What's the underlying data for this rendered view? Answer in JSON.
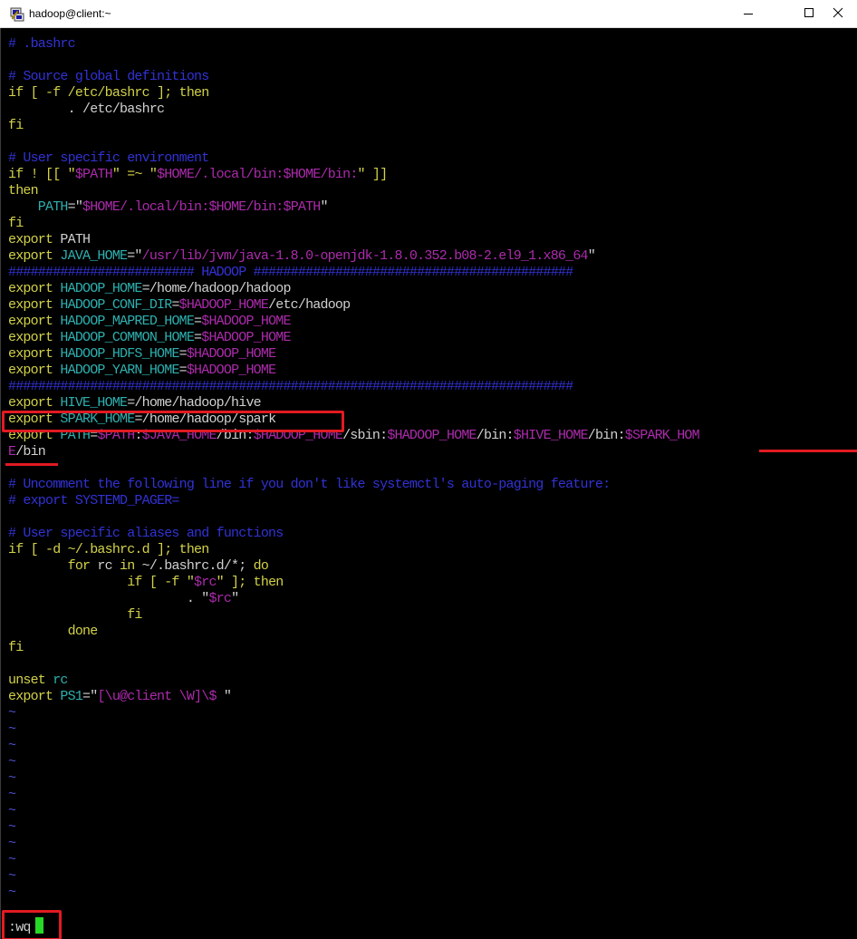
{
  "window": {
    "title": "hadoop@client:~",
    "controls": {
      "minimize": "minimize",
      "maximize": "maximize",
      "close": "close"
    }
  },
  "editor": {
    "lines": [
      [
        {
          "t": "# .bashrc",
          "c": "c-blue"
        }
      ],
      [
        {
          "t": "",
          "c": "c-wht"
        }
      ],
      [
        {
          "t": "# Source global definitions",
          "c": "c-blue"
        }
      ],
      [
        {
          "t": "if [ -f /etc/bashrc ]; then",
          "c": "c-yel"
        }
      ],
      [
        {
          "t": "        . /etc/bashrc",
          "c": "c-wht"
        }
      ],
      [
        {
          "t": "fi",
          "c": "c-yel"
        }
      ],
      [
        {
          "t": "",
          "c": "c-wht"
        }
      ],
      [
        {
          "t": "# User specific environment",
          "c": "c-blue"
        }
      ],
      [
        {
          "t": "if ! [[ \"",
          "c": "c-yel"
        },
        {
          "t": "$PATH",
          "c": "c-mag"
        },
        {
          "t": "\" =~ \"",
          "c": "c-yel"
        },
        {
          "t": "$HOME",
          "c": "c-mag"
        },
        {
          "t": "/.local/bin:",
          "c": "c-mag"
        },
        {
          "t": "$HOME",
          "c": "c-mag"
        },
        {
          "t": "/bin:",
          "c": "c-mag"
        },
        {
          "t": "\" ]]",
          "c": "c-yel"
        }
      ],
      [
        {
          "t": "then",
          "c": "c-yel"
        }
      ],
      [
        {
          "t": "    PATH",
          "c": "c-cyan"
        },
        {
          "t": "=\"",
          "c": "c-wht"
        },
        {
          "t": "$HOME",
          "c": "c-mag"
        },
        {
          "t": "/.local/bin:",
          "c": "c-mag"
        },
        {
          "t": "$HOME",
          "c": "c-mag"
        },
        {
          "t": "/bin:",
          "c": "c-mag"
        },
        {
          "t": "$PATH",
          "c": "c-mag"
        },
        {
          "t": "\"",
          "c": "c-wht"
        }
      ],
      [
        {
          "t": "fi",
          "c": "c-yel"
        }
      ],
      [
        {
          "t": "export",
          "c": "c-yel"
        },
        {
          "t": " PATH",
          "c": "c-wht"
        }
      ],
      [
        {
          "t": "export",
          "c": "c-yel"
        },
        {
          "t": " JAVA_HOME",
          "c": "c-cyan"
        },
        {
          "t": "=\"",
          "c": "c-wht"
        },
        {
          "t": "/usr/lib/jvm/java-1.8.0-openjdk-1.8.0.352.b08-2.el9_1.x86_64",
          "c": "c-mag"
        },
        {
          "t": "\"",
          "c": "c-wht"
        }
      ],
      [
        {
          "t": "######################### HADOOP ###########################################",
          "c": "c-blue"
        }
      ],
      [
        {
          "t": "export",
          "c": "c-yel"
        },
        {
          "t": " HADOOP_HOME",
          "c": "c-cyan"
        },
        {
          "t": "=/home/hadoop/hadoop",
          "c": "c-wht"
        }
      ],
      [
        {
          "t": "export",
          "c": "c-yel"
        },
        {
          "t": " HADOOP_CONF_DIR",
          "c": "c-cyan"
        },
        {
          "t": "=",
          "c": "c-wht"
        },
        {
          "t": "$HADOOP_HOME",
          "c": "c-mag"
        },
        {
          "t": "/etc/hadoop",
          "c": "c-wht"
        }
      ],
      [
        {
          "t": "export",
          "c": "c-yel"
        },
        {
          "t": " HADOOP_MAPRED_HOME",
          "c": "c-cyan"
        },
        {
          "t": "=",
          "c": "c-wht"
        },
        {
          "t": "$HADOOP_HOME",
          "c": "c-mag"
        }
      ],
      [
        {
          "t": "export",
          "c": "c-yel"
        },
        {
          "t": " HADOOP_COMMON_HOME",
          "c": "c-cyan"
        },
        {
          "t": "=",
          "c": "c-wht"
        },
        {
          "t": "$HADOOP_HOME",
          "c": "c-mag"
        }
      ],
      [
        {
          "t": "export",
          "c": "c-yel"
        },
        {
          "t": " HADOOP_HDFS_HOME",
          "c": "c-cyan"
        },
        {
          "t": "=",
          "c": "c-wht"
        },
        {
          "t": "$HADOOP_HOME",
          "c": "c-mag"
        }
      ],
      [
        {
          "t": "export",
          "c": "c-yel"
        },
        {
          "t": " HADOOP_YARN_HOME",
          "c": "c-cyan"
        },
        {
          "t": "=",
          "c": "c-wht"
        },
        {
          "t": "$HADOOP_HOME",
          "c": "c-mag"
        }
      ],
      [
        {
          "t": "############################################################################",
          "c": "c-blue"
        }
      ],
      [
        {
          "t": "export",
          "c": "c-yel"
        },
        {
          "t": " HIVE_HOME",
          "c": "c-cyan"
        },
        {
          "t": "=/home/hadoop/hive",
          "c": "c-wht"
        }
      ],
      [
        {
          "t": "export",
          "c": "c-yel"
        },
        {
          "t": " SPARK_HOME",
          "c": "c-cyan"
        },
        {
          "t": "=/home/hadoop/spark",
          "c": "c-wht"
        }
      ],
      [
        {
          "t": "export",
          "c": "c-yel"
        },
        {
          "t": " PATH",
          "c": "c-cyan"
        },
        {
          "t": "=",
          "c": "c-wht"
        },
        {
          "t": "$PATH",
          "c": "c-mag"
        },
        {
          "t": ":",
          "c": "c-wht"
        },
        {
          "t": "$JAVA_HOME",
          "c": "c-mag"
        },
        {
          "t": "/bin:",
          "c": "c-wht"
        },
        {
          "t": "$HADOOP_HOME",
          "c": "c-mag"
        },
        {
          "t": "/sbin:",
          "c": "c-wht"
        },
        {
          "t": "$HADOOP_HOME",
          "c": "c-mag"
        },
        {
          "t": "/bin:",
          "c": "c-wht"
        },
        {
          "t": "$HIVE_HOME",
          "c": "c-mag"
        },
        {
          "t": "/bin:",
          "c": "c-wht"
        },
        {
          "t": "$SPARK_HOM",
          "c": "c-mag"
        }
      ],
      [
        {
          "t": "E",
          "c": "c-mag"
        },
        {
          "t": "/bin",
          "c": "c-wht"
        }
      ],
      [
        {
          "t": "",
          "c": "c-wht"
        }
      ],
      [
        {
          "t": "# Uncomment the following line if you don't like systemctl's auto-paging feature:",
          "c": "c-blue"
        }
      ],
      [
        {
          "t": "# export SYSTEMD_PAGER=",
          "c": "c-blue"
        }
      ],
      [
        {
          "t": "",
          "c": "c-wht"
        }
      ],
      [
        {
          "t": "# User specific aliases and functions",
          "c": "c-blue"
        }
      ],
      [
        {
          "t": "if [ -d ~/.bashrc.d ]; then",
          "c": "c-yel"
        }
      ],
      [
        {
          "t": "        for",
          "c": "c-yel"
        },
        {
          "t": " rc ",
          "c": "c-wht"
        },
        {
          "t": "in",
          "c": "c-yel"
        },
        {
          "t": " ~/.bashrc.d/*; ",
          "c": "c-wht"
        },
        {
          "t": "do",
          "c": "c-yel"
        }
      ],
      [
        {
          "t": "                if [ -f \"",
          "c": "c-yel"
        },
        {
          "t": "$rc",
          "c": "c-mag"
        },
        {
          "t": "\" ]; then",
          "c": "c-yel"
        }
      ],
      [
        {
          "t": "                        . \"",
          "c": "c-wht"
        },
        {
          "t": "$rc",
          "c": "c-mag"
        },
        {
          "t": "\"",
          "c": "c-wht"
        }
      ],
      [
        {
          "t": "                fi",
          "c": "c-yel"
        }
      ],
      [
        {
          "t": "        done",
          "c": "c-yel"
        }
      ],
      [
        {
          "t": "fi",
          "c": "c-yel"
        }
      ],
      [
        {
          "t": "",
          "c": "c-wht"
        }
      ],
      [
        {
          "t": "unset",
          "c": "c-yel"
        },
        {
          "t": " rc",
          "c": "c-cyan"
        }
      ],
      [
        {
          "t": "export",
          "c": "c-yel"
        },
        {
          "t": " PS1",
          "c": "c-cyan"
        },
        {
          "t": "=\"",
          "c": "c-wht"
        },
        {
          "t": "[\\u@client \\W]\\$ ",
          "c": "c-mag"
        },
        {
          "t": "\"",
          "c": "c-wht"
        }
      ]
    ],
    "tilde_glyph": "~",
    "tilde_count": 12,
    "command_line": ":wq"
  },
  "colors": {
    "highlight": "#e11a22",
    "cursor": "#27d827",
    "comment": "#3232d6",
    "keyword": "#d2d249",
    "string": "#ac2bac",
    "identifier": "#2eb0b0"
  }
}
